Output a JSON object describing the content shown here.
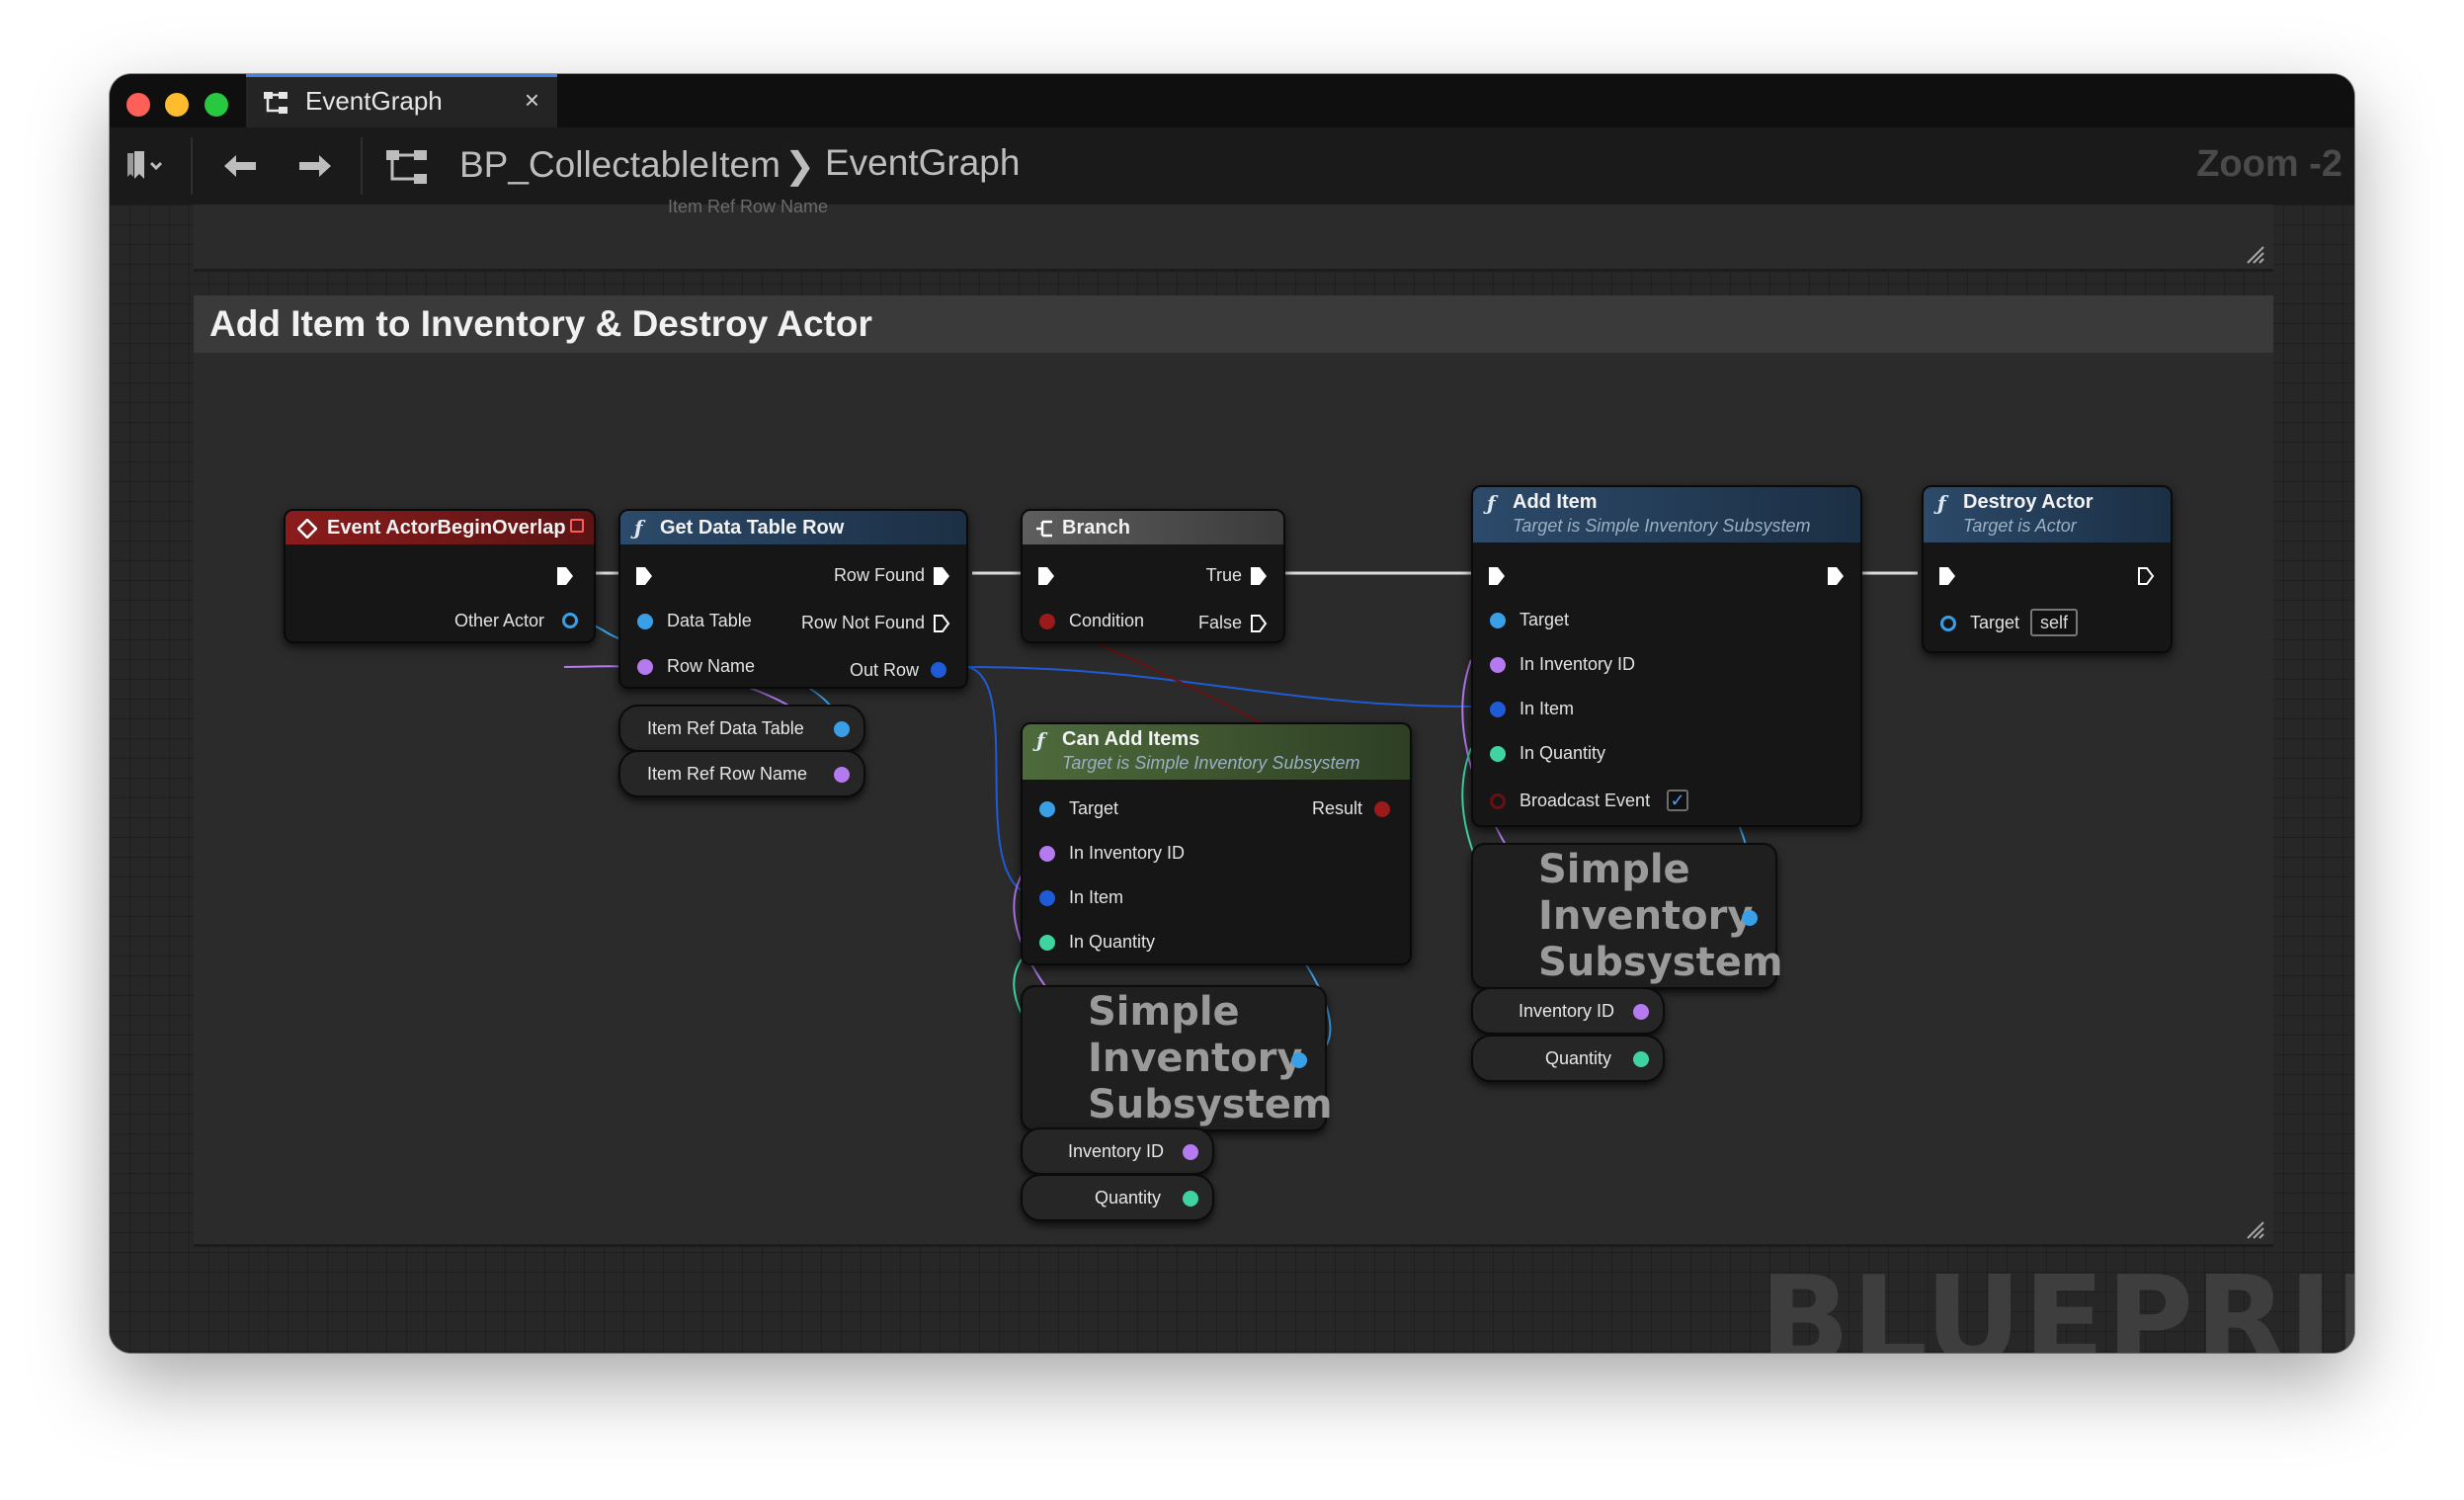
{
  "window": {
    "tab_title": "EventGraph",
    "tab_close": "×"
  },
  "toolbar": {
    "bookmark_icon": "bookmark-icon",
    "back_icon": "arrow-left-icon",
    "forward_icon": "arrow-right-icon",
    "breadcrumb_root": "BP_CollectableItem",
    "breadcrumb_separator": "❯",
    "breadcrumb_leaf": "EventGraph",
    "zoom": "Zoom -2"
  },
  "graph": {
    "ghost_text": "Item Ref Row Name",
    "comment_title": "Add Item to Inventory & Destroy Actor",
    "watermark": "BLUEPRINT"
  },
  "nodes": {
    "event_overlap": {
      "title": "Event ActorBeginOverlap",
      "other_actor": "Other Actor"
    },
    "get_data_table_row": {
      "title": "Get Data Table Row",
      "row_found": "Row Found",
      "row_not_found": "Row Not Found",
      "data_table": "Data Table",
      "row_name": "Row Name",
      "out_row": "Out Row"
    },
    "branch": {
      "title": "Branch",
      "true_label": "True",
      "false_label": "False",
      "condition": "Condition"
    },
    "add_item": {
      "title": "Add Item",
      "subtitle": "Target is Simple Inventory Subsystem",
      "target": "Target",
      "in_inventory_id": "In Inventory ID",
      "in_item": "In Item",
      "in_quantity": "In Quantity",
      "broadcast_event": "Broadcast Event",
      "broadcast_checked": "✓"
    },
    "destroy_actor": {
      "title": "Destroy Actor",
      "subtitle": "Target is Actor",
      "target": "Target",
      "target_value": "self"
    },
    "can_add_items": {
      "title": "Can Add Items",
      "subtitle": "Target is Simple Inventory Subsystem",
      "target": "Target",
      "result": "Result",
      "in_inventory_id": "In Inventory ID",
      "in_item": "In Item",
      "in_quantity": "In Quantity"
    }
  },
  "variables": {
    "item_ref_data_table": "Item Ref Data Table",
    "item_ref_row_name": "Item Ref Row Name",
    "subsystem_1": "Simple\nInventory\nSubsystem",
    "inventory_id_1": "Inventory ID",
    "quantity_1": "Quantity",
    "subsystem_2": "Simple\nInventory\nSubsystem",
    "inventory_id_2": "Inventory ID",
    "quantity_2": "Quantity"
  },
  "colors": {
    "event_header": "#8a1c1c",
    "function_header": "#2c4a6a",
    "pure_function_header": "#4e6b3c",
    "object_pin": "#39a0e8",
    "name_pin": "#b57af0",
    "struct_pin": "#1f5bd6",
    "int_pin": "#3fd3a0",
    "bool_pin": "#9b1a1a",
    "exec_pin": "#ffffff"
  }
}
